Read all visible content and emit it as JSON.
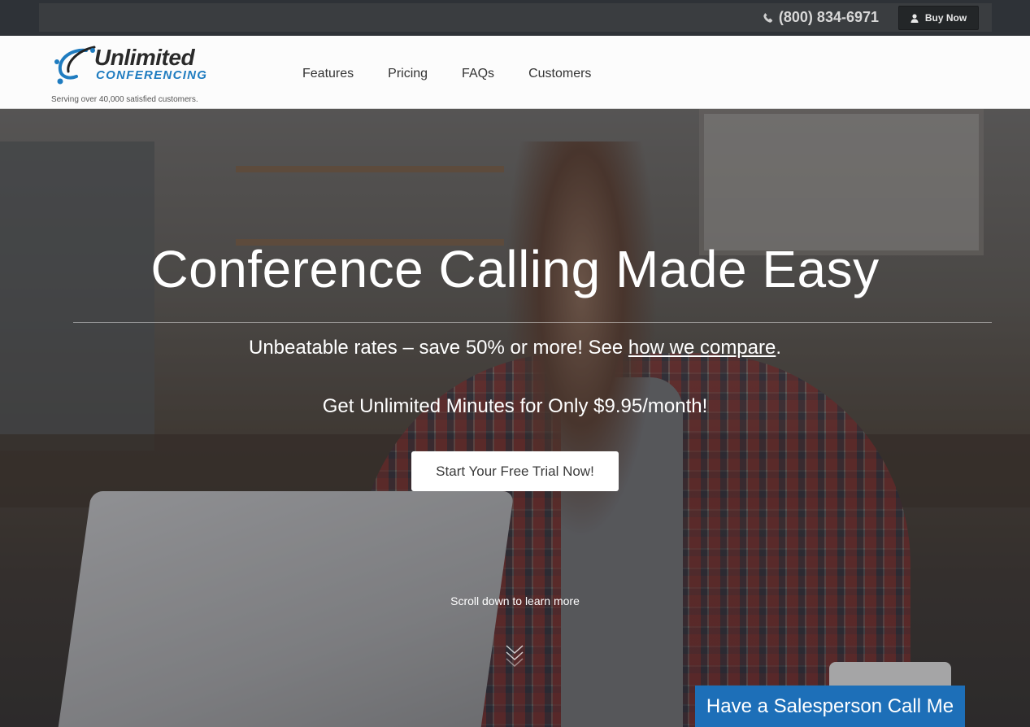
{
  "topbar": {
    "phone": "(800) 834-6971",
    "phone_icon": "phone-icon",
    "buy_now_label": "Buy Now",
    "buy_now_icon": "user-icon"
  },
  "header": {
    "logo_title": "Unlimited",
    "logo_subtitle": "conferencing",
    "tagline": "Serving over 40,000 satisfied customers.",
    "nav": [
      {
        "label": "Features"
      },
      {
        "label": "Pricing"
      },
      {
        "label": "FAQs"
      },
      {
        "label": "Customers"
      }
    ]
  },
  "hero": {
    "title": "Conference Calling Made Easy",
    "subtitle_prefix": "Unbeatable rates – save 50% or more! See ",
    "subtitle_link": "how we compare",
    "subtitle_suffix": ".",
    "offer": "Get Unlimited Minutes for Only $9.95/month!",
    "cta_label": "Start Your Free Trial Now!",
    "scroll_text": "Scroll down to learn more",
    "scroll_icon": "double-chevron-down-icon",
    "sales_button_label": "Have a Salesperson Call Me"
  },
  "colors": {
    "accent": "#1d6fb8",
    "logo_blue": "#1f7cc0",
    "topbar": "#2e3237"
  }
}
